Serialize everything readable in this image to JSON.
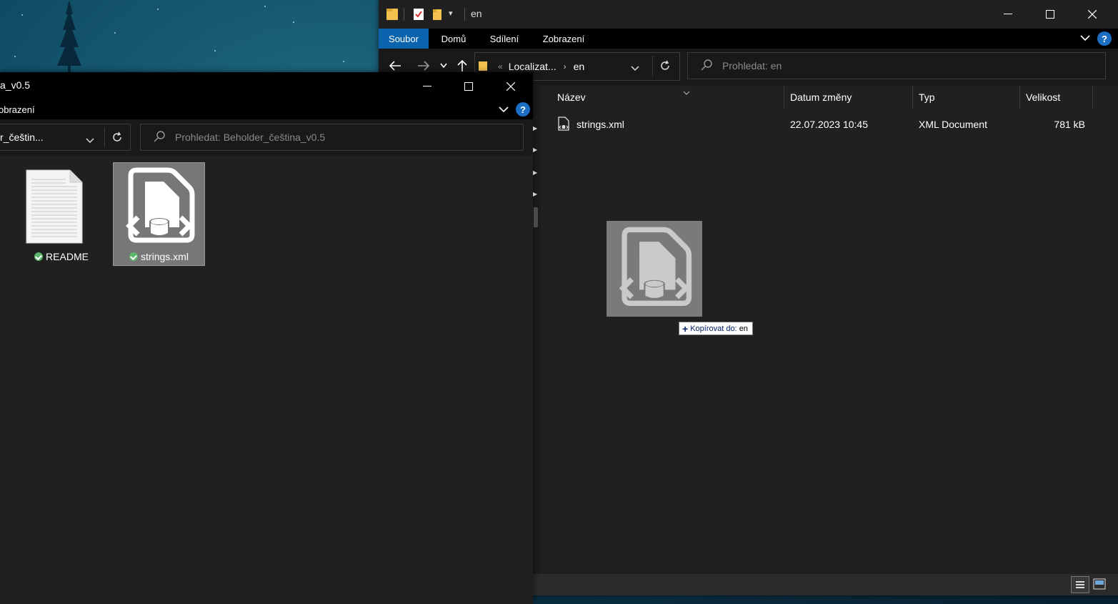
{
  "right_window": {
    "title": "en",
    "tabs": [
      {
        "label": "Soubor",
        "active": true
      },
      {
        "label": "Domů",
        "active": false
      },
      {
        "label": "Sdílení",
        "active": false
      },
      {
        "label": "Zobrazení",
        "active": false
      }
    ],
    "breadcrumb": [
      "Localizat...",
      "en"
    ],
    "search_placeholder": "Prohledat: en",
    "columns": {
      "name": "Název",
      "date": "Datum změny",
      "type": "Typ",
      "size": "Velikost"
    },
    "files": [
      {
        "name": "strings.xml",
        "date": "22.07.2023 10:45",
        "type": "XML Document",
        "size": "781 kB"
      }
    ],
    "help": "?"
  },
  "left_window": {
    "title": "a_v0.5",
    "ribbon_tab": "obrazení",
    "address": "r_češtin...",
    "search_placeholder": "Prohledat: Beholder_čeština_v0.5",
    "help": "?",
    "items": [
      {
        "name": "README",
        "synced": true,
        "selected": false
      },
      {
        "name": "strings.xml",
        "synced": true,
        "selected": true
      }
    ]
  },
  "drag": {
    "tooltip_prefix": "Kopírovat do:",
    "tooltip_target": "en"
  },
  "colors": {
    "accent": "#0a64ad",
    "window_bg": "#202020",
    "titlebar_bg": "#000000",
    "selection_bg": "#777777",
    "sync_green": "#5bb56a"
  }
}
